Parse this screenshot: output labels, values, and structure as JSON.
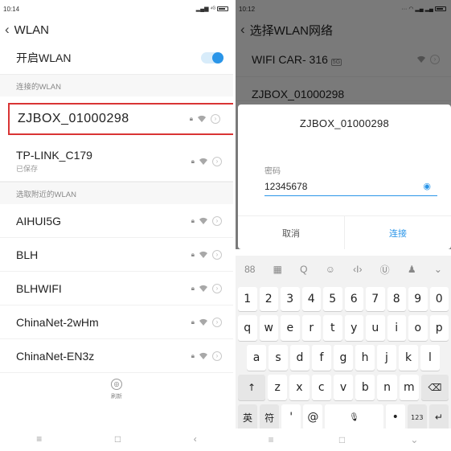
{
  "left": {
    "status": {
      "time": "10:14",
      "signal": "⁴ᴳ"
    },
    "title": "WLAN",
    "toggle_label": "开启WLAN",
    "connected_section": "连接的WLAN",
    "connected": {
      "name": "ZJBOX_01000298"
    },
    "saved": {
      "name": "TP-LINK_C179",
      "sub": "已保存"
    },
    "nearby_section": "选取附近的WLAN",
    "networks": [
      {
        "name": "AIHUI5G"
      },
      {
        "name": "BLH"
      },
      {
        "name": "BLHWIFI"
      },
      {
        "name": "ChinaNet-2wHm"
      },
      {
        "name": "ChinaNet-EN3z"
      }
    ],
    "refresh_label": "刷新",
    "nav": [
      "≡",
      "□",
      "‹"
    ]
  },
  "right": {
    "status": {
      "time": "10:12"
    },
    "title": "选择WLAN网络",
    "networks": [
      {
        "name": "WIFI CAR- 316",
        "badge": "5G"
      },
      {
        "name": "ZJBOX_01000298"
      }
    ],
    "dialog": {
      "title": "ZJBOX_01000298",
      "password_label": "密码",
      "password_value": "12345678",
      "cancel": "取消",
      "connect": "连接"
    },
    "keyboard": {
      "tools": [
        "88",
        "▦",
        "Q",
        "☺",
        "‹I›",
        "Ⓤ",
        "♟",
        "⌄"
      ],
      "numbers": [
        "1",
        "2",
        "3",
        "4",
        "5",
        "6",
        "7",
        "8",
        "9",
        "0"
      ],
      "row1": [
        "q",
        "w",
        "e",
        "r",
        "t",
        "y",
        "u",
        "i",
        "o",
        "p"
      ],
      "row2": [
        "a",
        "s",
        "d",
        "f",
        "g",
        "h",
        "j",
        "k",
        "l"
      ],
      "row3": [
        "z",
        "x",
        "c",
        "v",
        "b",
        "n",
        "m"
      ],
      "shift": "↑",
      "backspace": "⌫",
      "lang": "英",
      "symbol": "符",
      "apostrophe": "'",
      "at": "@",
      "dot": "•",
      "num_mode": "123",
      "enter": "↵"
    },
    "nav": [
      "≡",
      "□",
      "⌄"
    ]
  }
}
